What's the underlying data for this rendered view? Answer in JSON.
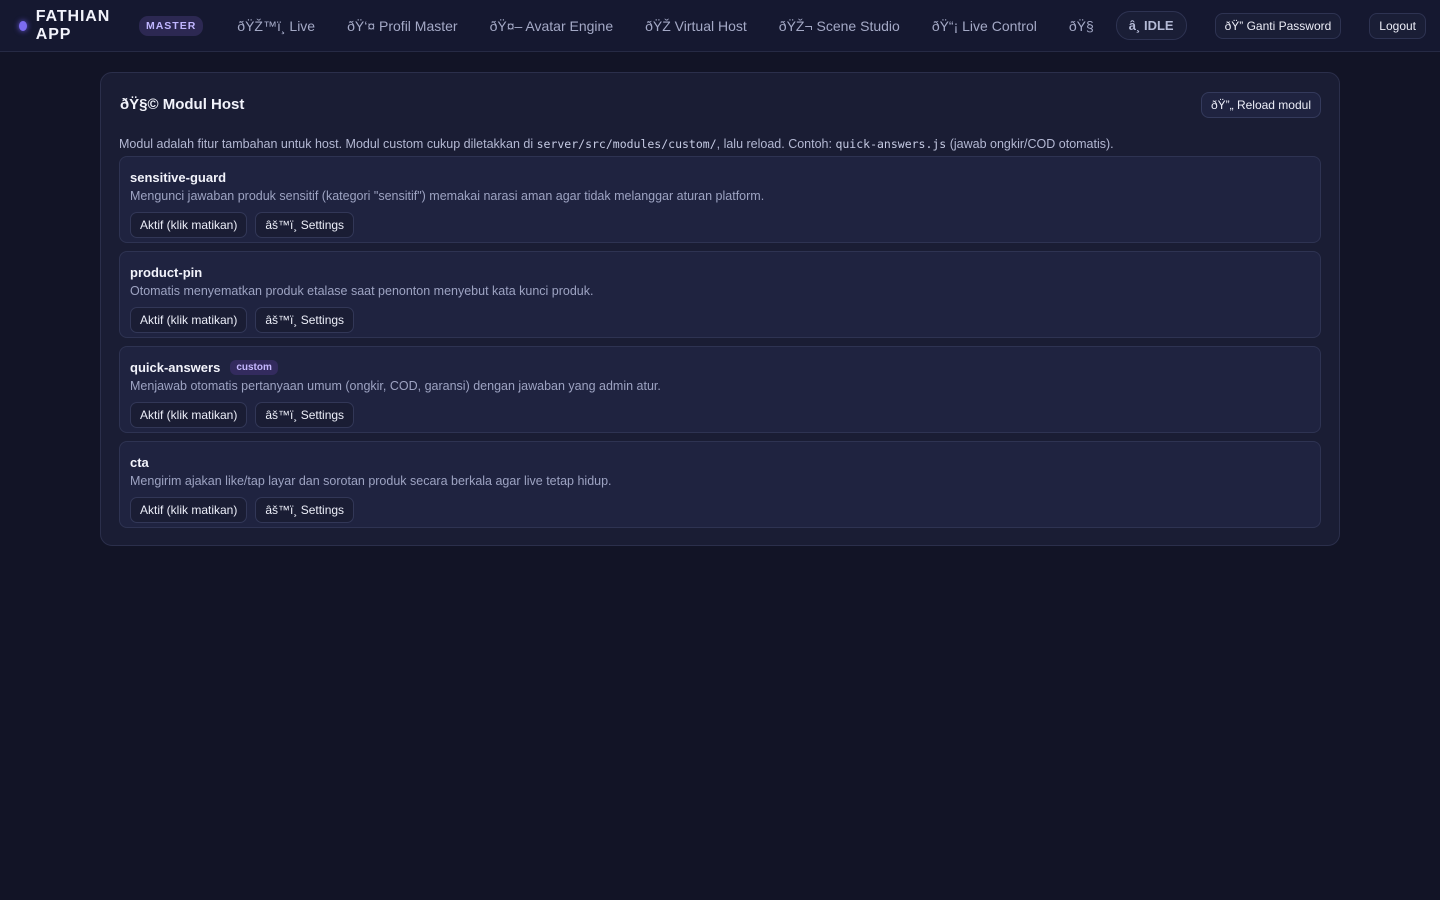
{
  "app": {
    "name": "FATHIAN APP",
    "role_badge": "MASTER",
    "accent_color": "#7c6cf0"
  },
  "nav": {
    "items": [
      {
        "label": "ðŸŽ™ï¸ Live"
      },
      {
        "label": "ðŸ‘¤ Profil Master"
      },
      {
        "label": "ðŸ¤– Avatar Engine"
      },
      {
        "label": "ðŸŽ Virtual Host"
      },
      {
        "label": "ðŸŽ¬ Scene Studio"
      },
      {
        "label": "ðŸ“¡ Live Control"
      },
      {
        "label": "ðŸ§"
      }
    ],
    "status_label": "â¸ IDLE",
    "password_button": "ðŸ” Ganti Password",
    "logout_button": "Logout"
  },
  "page": {
    "title": "ðŸ§© Modul Host",
    "reload_button": "ðŸ”„ Reload modul",
    "description": {
      "p1": "Modul adalah fitur tambahan untuk host. Modul custom cukup diletakkan di ",
      "code1": "server/src/modules/custom/",
      "p2": ", lalu reload. Contoh: ",
      "code2": "quick-answers.js",
      "p3": " (jawab ongkir/COD otomatis)."
    }
  },
  "modules": [
    {
      "name": "sensitive-guard",
      "badge": "",
      "description": "Mengunci jawaban produk sensitif (kategori \"sensitif\") memakai narasi aman agar tidak melanggar aturan platform.",
      "toggle_label": "Aktif (klik matikan)",
      "settings_label": "âš™ï¸ Settings"
    },
    {
      "name": "product-pin",
      "badge": "",
      "description": "Otomatis menyematkan produk etalase saat penonton menyebut kata kunci produk.",
      "toggle_label": "Aktif (klik matikan)",
      "settings_label": "âš™ï¸ Settings"
    },
    {
      "name": "quick-answers",
      "badge": "custom",
      "description": "Menjawab otomatis pertanyaan umum (ongkir, COD, garansi) dengan jawaban yang admin atur.",
      "toggle_label": "Aktif (klik matikan)",
      "settings_label": "âš™ï¸ Settings"
    },
    {
      "name": "cta",
      "badge": "",
      "description": "Mengirim ajakan like/tap layar dan sorotan produk secara berkala agar live tetap hidup.",
      "toggle_label": "Aktif (klik matikan)",
      "settings_label": "âš™ï¸ Settings"
    }
  ]
}
